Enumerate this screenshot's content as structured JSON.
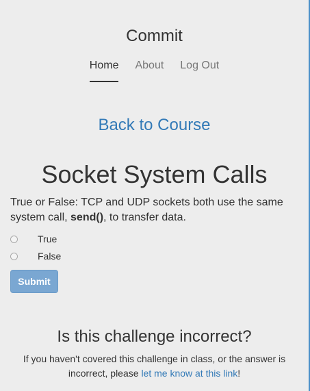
{
  "header": {
    "title": "Commit",
    "nav": {
      "home": "Home",
      "about": "About",
      "logout": "Log Out"
    }
  },
  "back_link": "Back to Course",
  "question": {
    "title": "Socket System Calls",
    "text_before": "True or False: TCP and UDP sockets both use the same system call, ",
    "text_bold": "send()",
    "text_after": ", to transfer data.",
    "options": [
      "True",
      "False"
    ],
    "submit_label": "Submit"
  },
  "report": {
    "heading": "Is this challenge incorrect?",
    "text_before": "If you haven't covered this challenge in class, or the answer is incorrect, please ",
    "link_text": "let me know at this link",
    "text_after": "!"
  },
  "colors": {
    "background": "#ededed",
    "link": "#337ab7",
    "button": "#7aa7d2"
  }
}
